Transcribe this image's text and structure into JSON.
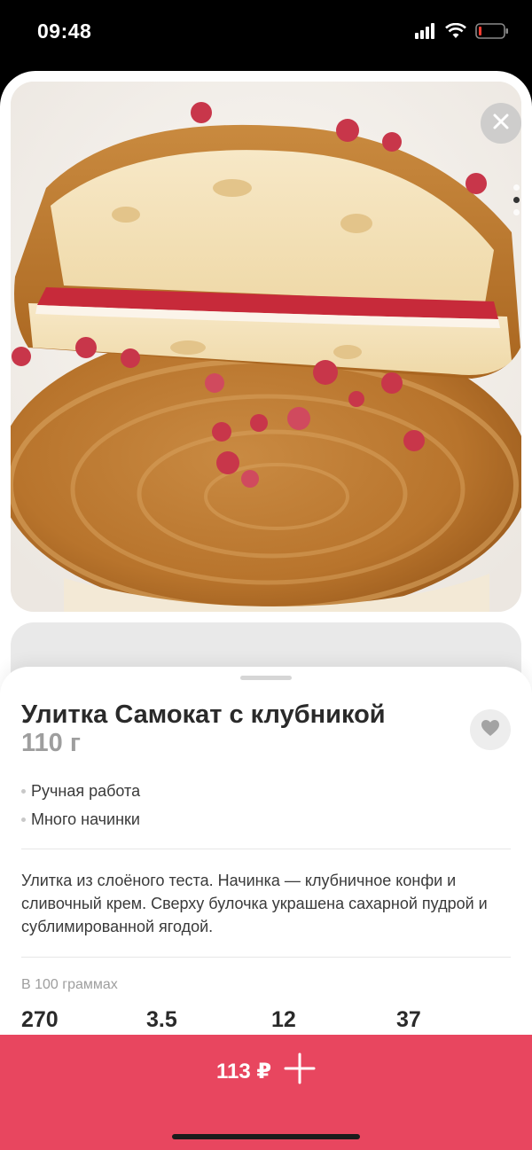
{
  "status_bar": {
    "time": "09:48"
  },
  "product": {
    "title": "Улитка Самокат с клубникой",
    "weight": "110 г",
    "features": [
      "Ручная работа",
      "Много начинки"
    ],
    "description": "Улитка из слоёного теста. Начинка — клубничное конфи и сливочный крем. Сверху булочка украшена сахарной пудрой и сублимированной ягодой.",
    "per_100_label": "В 100 граммах",
    "nutrition": [
      "270",
      "3.5",
      "12",
      "37"
    ]
  },
  "gallery": {
    "total": 3,
    "active_index": 0
  },
  "cart": {
    "price": "113 ₽"
  },
  "colors": {
    "accent": "#e8465f"
  }
}
